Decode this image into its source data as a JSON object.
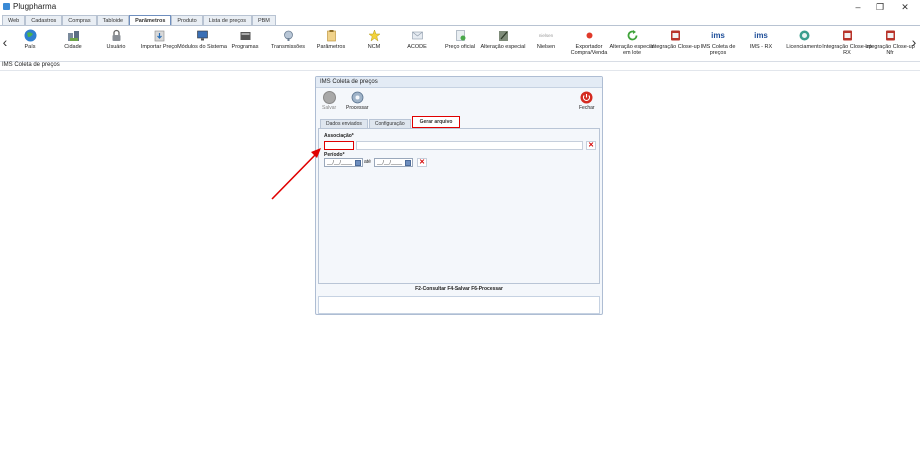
{
  "window": {
    "title": "Plugpharma",
    "minimize": "–",
    "maximize": "❐",
    "close": "✕"
  },
  "menu_tabs": [
    "Web",
    "Cadastros",
    "Compras",
    "Tabloide",
    "Parâmetros",
    "Produto",
    "Lista de preços",
    "PBM"
  ],
  "ribbon": {
    "left_arrow": "‹",
    "right_arrow": "›",
    "items": [
      {
        "label": "País",
        "icon": "globe-icon"
      },
      {
        "label": "Cidade",
        "icon": "city-icon"
      },
      {
        "label": "Usuário",
        "icon": "lock-icon"
      },
      {
        "label": "Importar Preço",
        "icon": "import-icon"
      },
      {
        "label": "Módulos do Sistema",
        "icon": "monitor-icon"
      },
      {
        "label": "Programas",
        "icon": "programs-icon"
      },
      {
        "label": "Transmissões",
        "icon": "satellite-icon"
      },
      {
        "label": "Parâmetros",
        "icon": "clipboard-icon"
      },
      {
        "label": "NCM",
        "icon": "star-icon"
      },
      {
        "label": "ACODE",
        "icon": "envelope-icon"
      },
      {
        "label": "Preço oficial",
        "icon": "document-icon"
      },
      {
        "label": "Alteração especial",
        "icon": "edit-icon"
      },
      {
        "label": "Nielsen",
        "icon": "nielsen-icon",
        "icon_text": "nielsen"
      },
      {
        "label": "Exportador Compra/Venda",
        "icon": "export-icon"
      },
      {
        "label": "Alteração especial em lote",
        "icon": "refresh-icon"
      },
      {
        "label": "Integração Close-up",
        "icon": "closeup-icon"
      },
      {
        "label": "IMS Coleta de preços",
        "icon": "ims-icon",
        "icon_text": "ims"
      },
      {
        "label": "IMS - RX",
        "icon": "ims-rx-icon",
        "icon_text": "ims"
      },
      {
        "label": "Licenciamento",
        "icon": "license-icon"
      },
      {
        "label": "Integração Close-up RX",
        "icon": "closeup-rx-icon"
      },
      {
        "label": "Integração Close-up Nfr",
        "icon": "closeup-nfr-icon"
      }
    ]
  },
  "breadcrumb": "IMS Coleta de preços",
  "dialog": {
    "title": "IMS Coleta de preços",
    "save_label": "Salvar",
    "process_label": "Processar",
    "close_label": "Fechar",
    "tabs": [
      "Dados enviados",
      "Configuração",
      "Gerar arquivo"
    ],
    "active_tab": "Gerar arquivo",
    "association_label": "Associação*",
    "association_code": "",
    "association_name": "",
    "period_label": "Período*",
    "date_from": "__/__/____",
    "date_to": "__/__/____",
    "date_sep": "até",
    "shortcuts": "F2-Consultar F4-Salvar F6-Processar"
  },
  "colors": {
    "highlight": "#e00000",
    "accent": "#6f8fbf",
    "close_red": "#d40000"
  }
}
